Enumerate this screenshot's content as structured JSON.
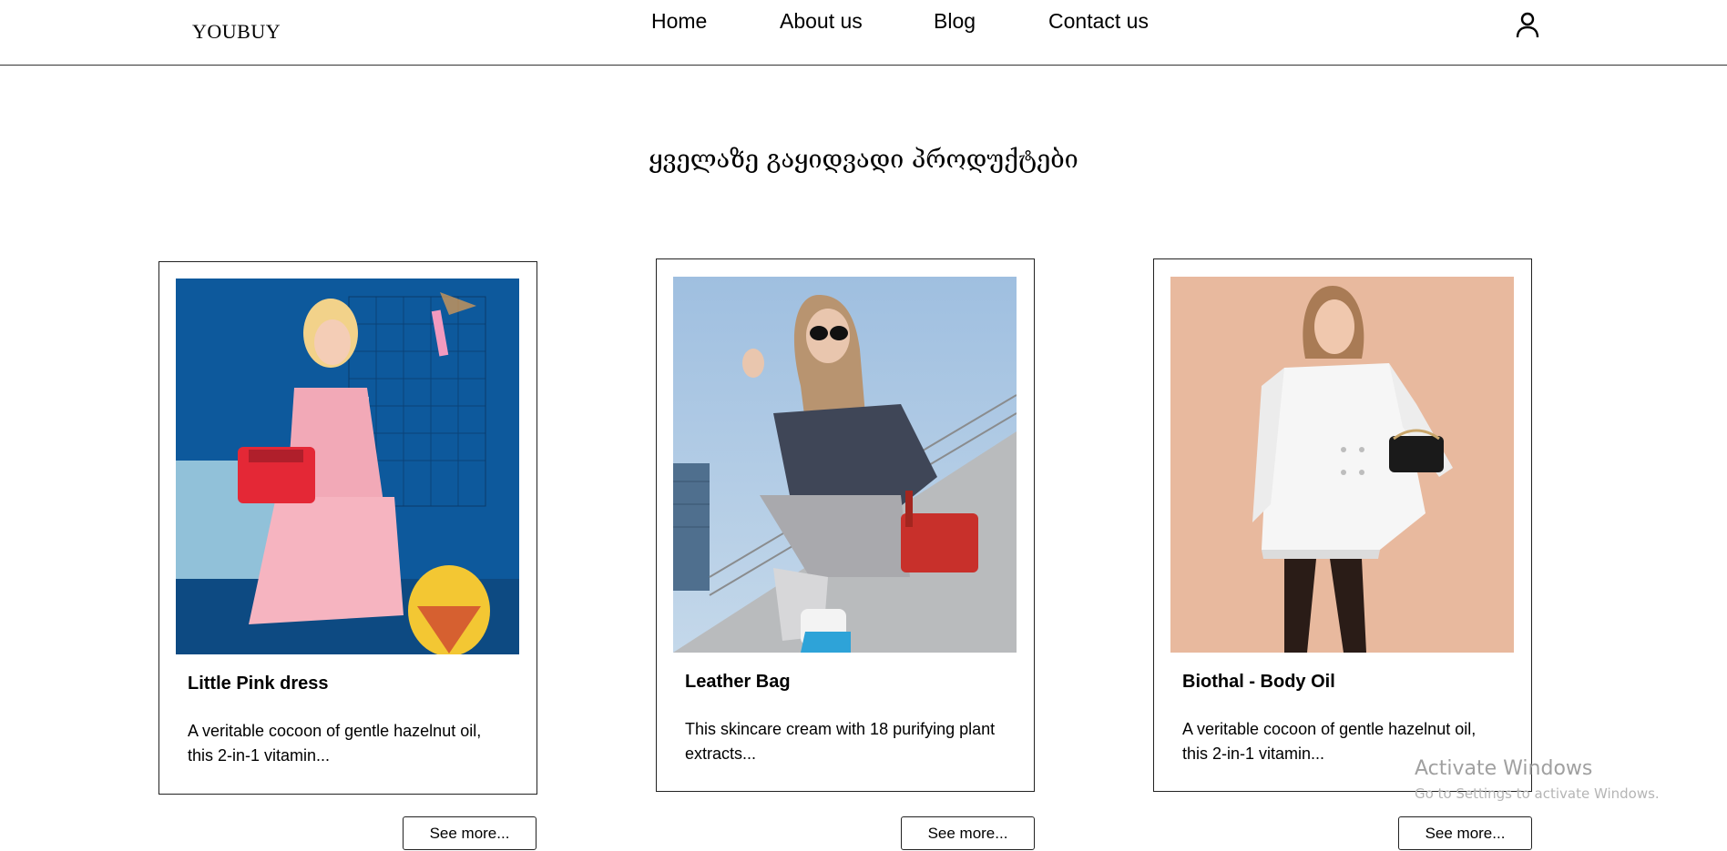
{
  "header": {
    "logo": "YOUBUY",
    "nav": [
      "Home",
      "About us",
      "Blog",
      "Contact us"
    ],
    "user_icon": "user-icon"
  },
  "section": {
    "title": "ყველაზე გაყიდვადი პროდუქტები"
  },
  "products": [
    {
      "name": "Little Pink dress",
      "description": "A veritable cocoon of gentle hazelnut oil, this 2-in-1 vitamin...",
      "button": "See more...",
      "image_bg": "#0f5fa3"
    },
    {
      "name": "Leather Bag",
      "description": "This skincare cream with 18 purifying plant extracts...",
      "button": "See more...",
      "image_bg": "#9bb9d8"
    },
    {
      "name": "Biothal - Body Oil",
      "description": "A veritable cocoon of gentle hazelnut oil, this 2-in-1 vitamin...",
      "button": "See more...",
      "image_bg": "#e8b99e"
    }
  ],
  "watermark": {
    "title": "Activate Windows",
    "subtitle": "Go to Settings to activate Windows."
  }
}
